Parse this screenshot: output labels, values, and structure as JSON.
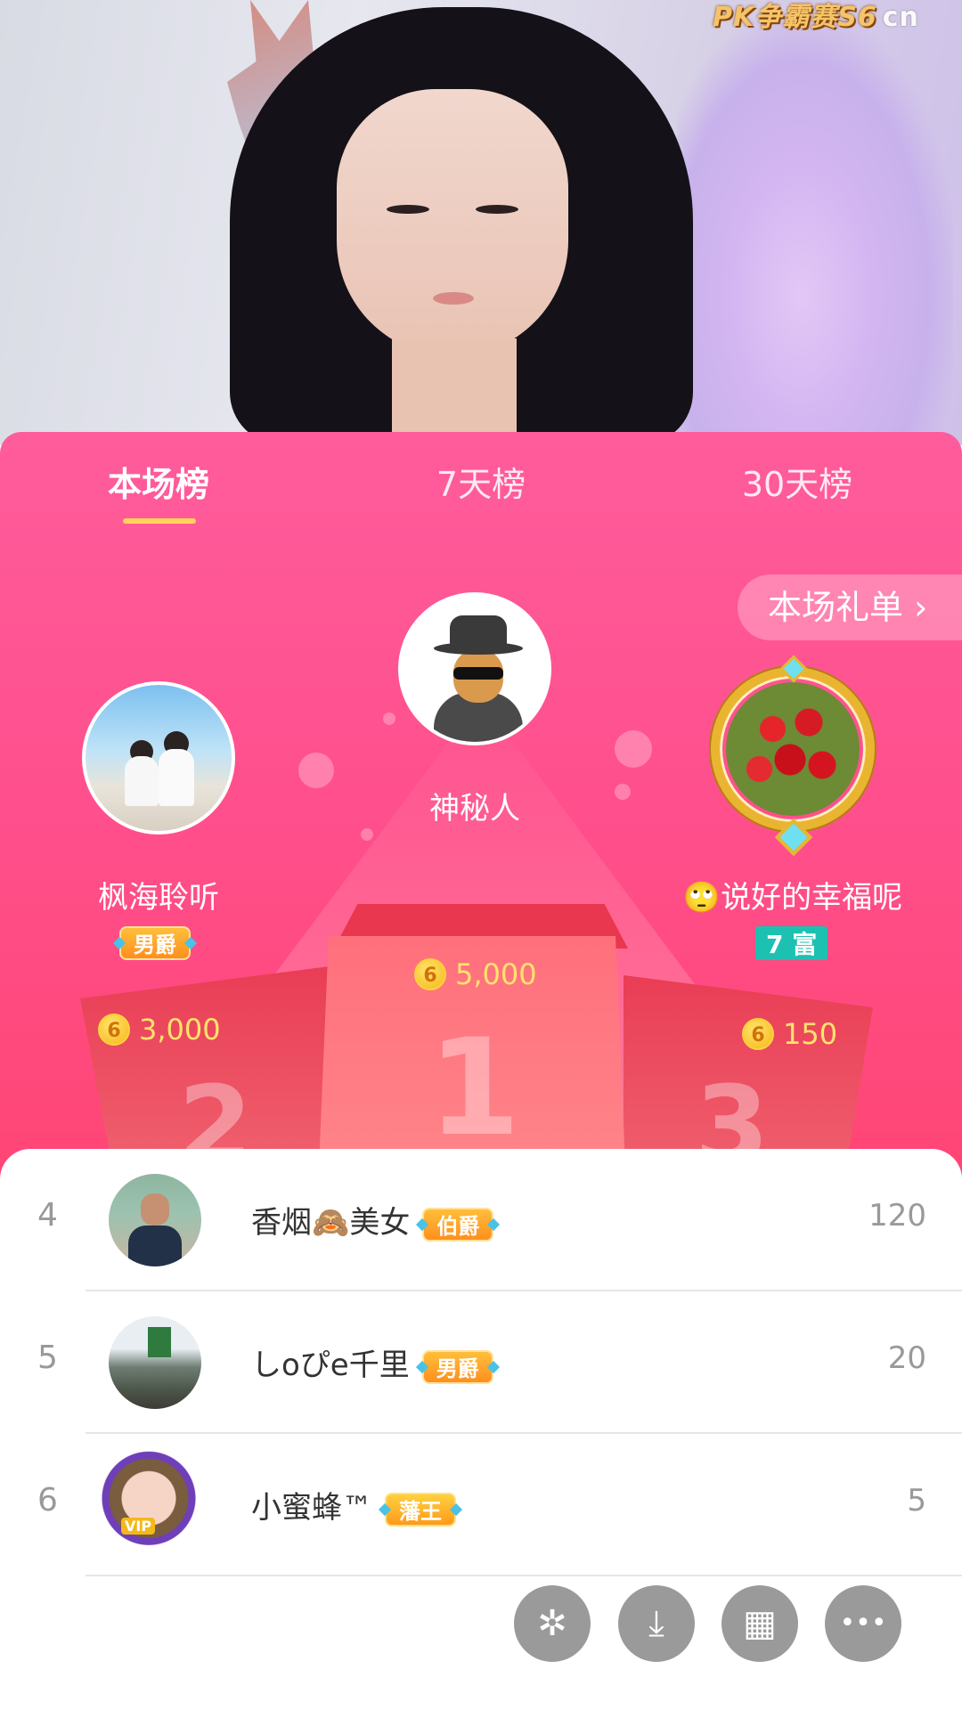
{
  "video": {
    "watermark_text": "PK争霸赛S6",
    "watermark_site": "cn"
  },
  "tabs": [
    {
      "label": "本场榜",
      "active": true
    },
    {
      "label": "7天榜",
      "active": false
    },
    {
      "label": "30天榜",
      "active": false
    }
  ],
  "gift_list_button": "本场礼单 ›",
  "podium": {
    "first": {
      "rank": "1",
      "name": "神秘人",
      "score": "5,000"
    },
    "second": {
      "rank": "2",
      "name": "枫海聆听",
      "badge": "男爵",
      "score": "3,000"
    },
    "third": {
      "rank": "3",
      "name": "🙄说好的幸福呢",
      "badge": "7 富",
      "score": "150"
    }
  },
  "coin_symbol": "6",
  "list": [
    {
      "rank": "4",
      "name": "香烟🙈美女",
      "badge": "伯爵",
      "score": "120"
    },
    {
      "rank": "5",
      "name": "しoぴe千里",
      "badge": "男爵",
      "score": "20"
    },
    {
      "rank": "6",
      "name": "小蜜蜂™",
      "badge": "藩王",
      "score": "5"
    }
  ],
  "actions": [
    {
      "icon": "pinwheel-icon",
      "glyph": "✲"
    },
    {
      "icon": "download-icon",
      "glyph": "⤓"
    },
    {
      "icon": "grid-icon",
      "glyph": "▦"
    },
    {
      "icon": "more-icon",
      "glyph": "•••"
    }
  ],
  "colors": {
    "panel_top": "#ff5c9c",
    "panel_bottom": "#ff4a66",
    "tab_underline": "#ffd35a",
    "coin_text": "#ffe36c",
    "rich_badge": "#1cc1b2"
  }
}
